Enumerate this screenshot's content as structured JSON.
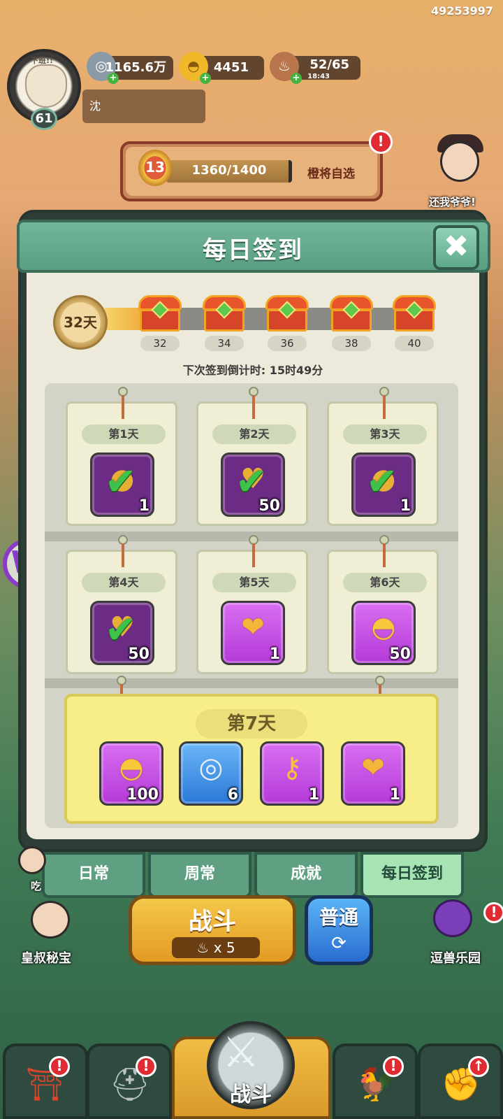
{
  "user_id": "49253997",
  "player": {
    "name": "沈",
    "level": "61",
    "avatar_caption": "下班!!"
  },
  "resources": [
    {
      "name": "silver-coin-icon",
      "value": "1165.6万"
    },
    {
      "name": "gold-ingot-icon",
      "value": "4451"
    },
    {
      "name": "meat-icon",
      "value": "52/65",
      "sub": "18:43"
    }
  ],
  "exp": {
    "level": "13",
    "text": "1360/1400",
    "progress": 0.971,
    "pick_label": "橙将自选"
  },
  "top_right_hero": {
    "label": "还我爷爷!"
  },
  "modal": {
    "title": "每日签到",
    "close_label": "✖",
    "streak_label": "32天",
    "milestones": [
      "32",
      "34",
      "36",
      "38",
      "40"
    ],
    "milestone_progress": 0.0,
    "countdown": "下次签到倒计时: 15时49分",
    "days": [
      {
        "label": "第1天",
        "icon": "gold-coin-icon",
        "count": "1",
        "claimed": true
      },
      {
        "label": "第2天",
        "icon": "heart-icon",
        "count": "50",
        "claimed": true
      },
      {
        "label": "第3天",
        "icon": "gold-coin-icon",
        "count": "1",
        "claimed": true
      },
      {
        "label": "第4天",
        "icon": "heart-icon",
        "count": "50",
        "claimed": true
      },
      {
        "label": "第5天",
        "icon": "heart-coin-icon",
        "count": "1",
        "claimed": false
      },
      {
        "label": "第6天",
        "icon": "gold-ingot-icon",
        "count": "50",
        "claimed": false
      }
    ],
    "day7": {
      "label": "第7天",
      "items": [
        {
          "icon": "gold-ingot-icon",
          "count": "100"
        },
        {
          "icon": "silver-coin-speed-icon",
          "count": "6"
        },
        {
          "icon": "key-icon",
          "count": "1"
        },
        {
          "icon": "heart-coin-icon",
          "count": "1"
        }
      ]
    }
  },
  "tabs": [
    {
      "label": "日常",
      "active": false
    },
    {
      "label": "周常",
      "active": false
    },
    {
      "label": "成就",
      "active": false
    },
    {
      "label": "每日签到",
      "active": true
    }
  ],
  "side_left": {
    "label": "皇叔秘宝",
    "partial_label": "吃"
  },
  "side_right": {
    "label": "逗兽乐园"
  },
  "battle": {
    "label": "战斗",
    "cost": "x 5"
  },
  "mode": {
    "label": "普通",
    "icon": "refresh-icon"
  },
  "bottom_nav": [
    {
      "icon": "temple-gate-icon",
      "alert": "!"
    },
    {
      "icon": "helmet-icon",
      "alert": "!"
    },
    {
      "icon": "crossed-swords-icon",
      "label": "战斗"
    },
    {
      "icon": "rooster-icon",
      "alert": "!"
    },
    {
      "icon": "fist-upgrade-icon",
      "alert": "↑"
    }
  ],
  "colors": {
    "accent_green": "#5fa083",
    "modal_bg": "#eeeadb",
    "claimed_purple": "#6c2c86",
    "gold": "#f4c74a",
    "alert_red": "#e02b32"
  }
}
